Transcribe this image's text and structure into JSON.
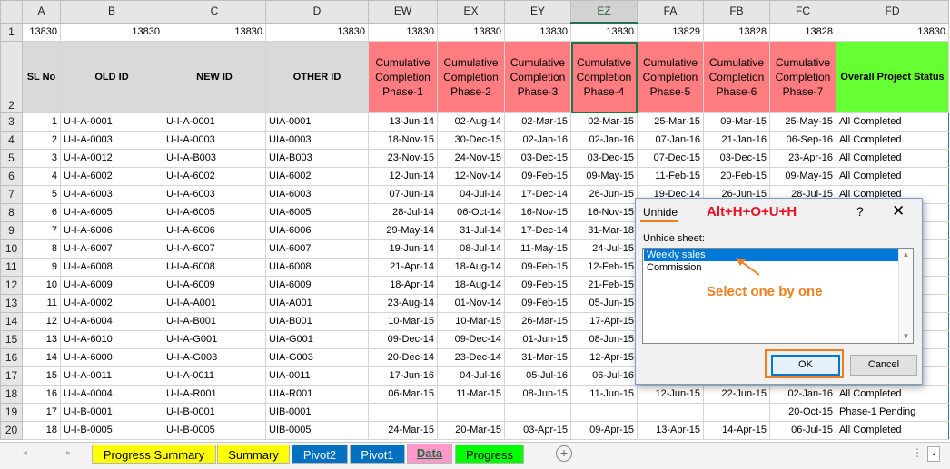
{
  "columns": [
    "A",
    "B",
    "C",
    "D",
    "EW",
    "EX",
    "EY",
    "EZ",
    "FA",
    "FB",
    "FC",
    "FD"
  ],
  "row1": {
    "rownum": "1",
    "A": "13830",
    "B": "13830",
    "C": "13830",
    "D": "13830",
    "EW": "13830",
    "EX": "13830",
    "EY": "13830",
    "EZ": "13830",
    "FA": "13829",
    "FB": "13828",
    "FC": "13828",
    "FD": "13830"
  },
  "headers": {
    "rownum": "2",
    "A": "SL No",
    "B": "OLD ID",
    "C": "NEW ID",
    "D": "OTHER ID",
    "EW": "Cumulative Completion Phase-1",
    "EX": "Cumulative Completion Phase-2",
    "EY": "Cumulative Completion Phase-3",
    "EZ": "Cumulative Completion Phase-4",
    "FA": "Cumulative Completion Phase-5",
    "FB": "Cumulative Completion Phase-6",
    "FC": "Cumulative Completion Phase-7",
    "FD": "Overall Project Status"
  },
  "header_colors": {
    "gray": "#d9d9d9",
    "pink": "#ff7c80",
    "green": "#66ff33"
  },
  "rows": [
    {
      "rownum": "3",
      "A": "1",
      "B": "U-I-A-0001",
      "C": "U-I-A-0001",
      "D": "UIA-0001",
      "EW": "13-Jun-14",
      "EX": "02-Aug-14",
      "EY": "02-Mar-15",
      "EZ": "02-Mar-15",
      "FA": "25-Mar-15",
      "FB": "09-Mar-15",
      "FC": "25-May-15",
      "FD": "All Completed"
    },
    {
      "rownum": "4",
      "A": "2",
      "B": "U-I-A-0003",
      "C": "U-I-A-0003",
      "D": "UIA-0003",
      "EW": "18-Nov-15",
      "EX": "30-Dec-15",
      "EY": "02-Jan-16",
      "EZ": "02-Jan-16",
      "FA": "07-Jan-16",
      "FB": "21-Jan-16",
      "FC": "06-Sep-16",
      "FD": "All Completed"
    },
    {
      "rownum": "5",
      "A": "3",
      "B": "U-I-A-0012",
      "C": "U-I-A-B003",
      "D": "UIA-B003",
      "EW": "23-Nov-15",
      "EX": "24-Nov-15",
      "EY": "03-Dec-15",
      "EZ": "03-Dec-15",
      "FA": "07-Dec-15",
      "FB": "03-Dec-15",
      "FC": "23-Apr-16",
      "FD": "All Completed"
    },
    {
      "rownum": "6",
      "A": "4",
      "B": "U-I-A-6002",
      "C": "U-I-A-6002",
      "D": "UIA-6002",
      "EW": "12-Jun-14",
      "EX": "12-Nov-14",
      "EY": "09-Feb-15",
      "EZ": "09-May-15",
      "FA": "11-Feb-15",
      "FB": "20-Feb-15",
      "FC": "09-May-15",
      "FD": "All Completed"
    },
    {
      "rownum": "7",
      "A": "5",
      "B": "U-I-A-6003",
      "C": "U-I-A-6003",
      "D": "UIA-6003",
      "EW": "07-Jun-14",
      "EX": "04-Jul-14",
      "EY": "17-Dec-14",
      "EZ": "26-Jun-15",
      "FA": "19-Dec-14",
      "FB": "26-Jun-15",
      "FC": "28-Jul-15",
      "FD": "All Completed"
    },
    {
      "rownum": "8",
      "A": "6",
      "B": "U-I-A-6005",
      "C": "U-I-A-6005",
      "D": "UIA-6005",
      "EW": "28-Jul-14",
      "EX": "06-Oct-14",
      "EY": "16-Nov-15",
      "EZ": "16-Nov-15",
      "FA": "",
      "FB": "",
      "FC": "",
      "FD": ""
    },
    {
      "rownum": "9",
      "A": "7",
      "B": "U-I-A-6006",
      "C": "U-I-A-6006",
      "D": "UIA-6006",
      "EW": "29-May-14",
      "EX": "31-Jul-14",
      "EY": "17-Dec-14",
      "EZ": "31-Mar-18",
      "FA": "",
      "FB": "",
      "FC": "",
      "FD": ""
    },
    {
      "rownum": "10",
      "A": "8",
      "B": "U-I-A-6007",
      "C": "U-I-A-6007",
      "D": "UIA-6007",
      "EW": "19-Jun-14",
      "EX": "08-Jul-14",
      "EY": "11-May-15",
      "EZ": "24-Jul-15",
      "FA": "",
      "FB": "",
      "FC": "",
      "FD": ""
    },
    {
      "rownum": "11",
      "A": "9",
      "B": "U-I-A-6008",
      "C": "U-I-A-6008",
      "D": "UIA-6008",
      "EW": "21-Apr-14",
      "EX": "18-Aug-14",
      "EY": "09-Feb-15",
      "EZ": "12-Feb-15",
      "FA": "",
      "FB": "",
      "FC": "",
      "FD": ""
    },
    {
      "rownum": "12",
      "A": "10",
      "B": "U-I-A-6009",
      "C": "U-I-A-6009",
      "D": "UIA-6009",
      "EW": "18-Apr-14",
      "EX": "18-Aug-14",
      "EY": "09-Feb-15",
      "EZ": "21-Feb-15",
      "FA": "",
      "FB": "",
      "FC": "",
      "FD": ""
    },
    {
      "rownum": "13",
      "A": "11",
      "B": "U-I-A-0002",
      "C": "U-I-A-A001",
      "D": "UIA-A001",
      "EW": "23-Aug-14",
      "EX": "01-Nov-14",
      "EY": "09-Feb-15",
      "EZ": "05-Jun-15",
      "FA": "",
      "FB": "",
      "FC": "",
      "FD": ""
    },
    {
      "rownum": "14",
      "A": "12",
      "B": "U-I-A-6004",
      "C": "U-I-A-B001",
      "D": "UIA-B001",
      "EW": "10-Mar-15",
      "EX": "10-Mar-15",
      "EY": "26-Mar-15",
      "EZ": "17-Apr-15",
      "FA": "",
      "FB": "",
      "FC": "",
      "FD": ""
    },
    {
      "rownum": "15",
      "A": "13",
      "B": "U-I-A-6010",
      "C": "U-I-A-G001",
      "D": "UIA-G001",
      "EW": "09-Dec-14",
      "EX": "09-Dec-14",
      "EY": "01-Jun-15",
      "EZ": "08-Jun-15",
      "FA": "",
      "FB": "",
      "FC": "",
      "FD": ""
    },
    {
      "rownum": "16",
      "A": "14",
      "B": "U-I-A-6000",
      "C": "U-I-A-G003",
      "D": "UIA-G003",
      "EW": "20-Dec-14",
      "EX": "23-Dec-14",
      "EY": "31-Mar-15",
      "EZ": "12-Apr-15",
      "FA": "",
      "FB": "",
      "FC": "",
      "FD": ""
    },
    {
      "rownum": "17",
      "A": "15",
      "B": "U-I-A-0011",
      "C": "U-I-A-0011",
      "D": "UIA-0011",
      "EW": "17-Jun-16",
      "EX": "04-Jul-16",
      "EY": "05-Jul-16",
      "EZ": "06-Jul-16",
      "FA": "",
      "FB": "",
      "FC": "",
      "FD": ""
    },
    {
      "rownum": "18",
      "A": "16",
      "B": "U-I-A-0004",
      "C": "U-I-A-R001",
      "D": "UIA-R001",
      "EW": "06-Mar-15",
      "EX": "11-Mar-15",
      "EY": "08-Jun-15",
      "EZ": "11-Jun-15",
      "FA": "12-Jun-15",
      "FB": "22-Jun-15",
      "FC": "02-Jan-16",
      "FD": "All Completed"
    },
    {
      "rownum": "19",
      "A": "17",
      "B": "U-I-B-0001",
      "C": "U-I-B-0001",
      "D": "UIB-0001",
      "EW": "",
      "EX": "",
      "EY": "",
      "EZ": "",
      "FA": "",
      "FB": "",
      "FC": "20-Oct-15",
      "FD": "Phase-1 Pending"
    },
    {
      "rownum": "20",
      "A": "18",
      "B": "U-I-B-0005",
      "C": "U-I-B-0005",
      "D": "UIB-0005",
      "EW": "24-Mar-15",
      "EX": "20-Mar-15",
      "EY": "03-Apr-15",
      "EZ": "09-Apr-15",
      "FA": "13-Apr-15",
      "FB": "14-Apr-15",
      "FC": "06-Jul-15",
      "FD": "All Completed"
    }
  ],
  "dialog": {
    "title": "Unhide",
    "hotkey_annotation": "Alt+H+O+U+H",
    "help": "?",
    "close": "✕",
    "list_label": "Unhide sheet:",
    "sheets": [
      "Weekly sales",
      "Commission"
    ],
    "selected_sheet": "Weekly sales",
    "annotation": "Select one by one",
    "ok": "OK",
    "cancel": "Cancel",
    "accent_color": "#f07e1d"
  },
  "tabs": [
    {
      "label": "Progress Summary",
      "color": "#ffff00",
      "text_color": "#000000"
    },
    {
      "label": "Summary",
      "color": "#ffff00",
      "text_color": "#000000"
    },
    {
      "label": "Pivot2",
      "color": "#0070c0",
      "text_color": "#ffffff"
    },
    {
      "label": "Pivot1",
      "color": "#0070c0",
      "text_color": "#ffffff"
    },
    {
      "label": "Data",
      "color": "#ff99cc",
      "text_color": "#1e6b3a",
      "active": true
    },
    {
      "label": "Progress",
      "color": "#00ff00",
      "text_color": "#000000"
    }
  ],
  "tabbar": {
    "add_sheet": "+",
    "more": "⋮",
    "scroll_left": "◂",
    "nav_prev": "◂",
    "nav_next": "▸"
  }
}
